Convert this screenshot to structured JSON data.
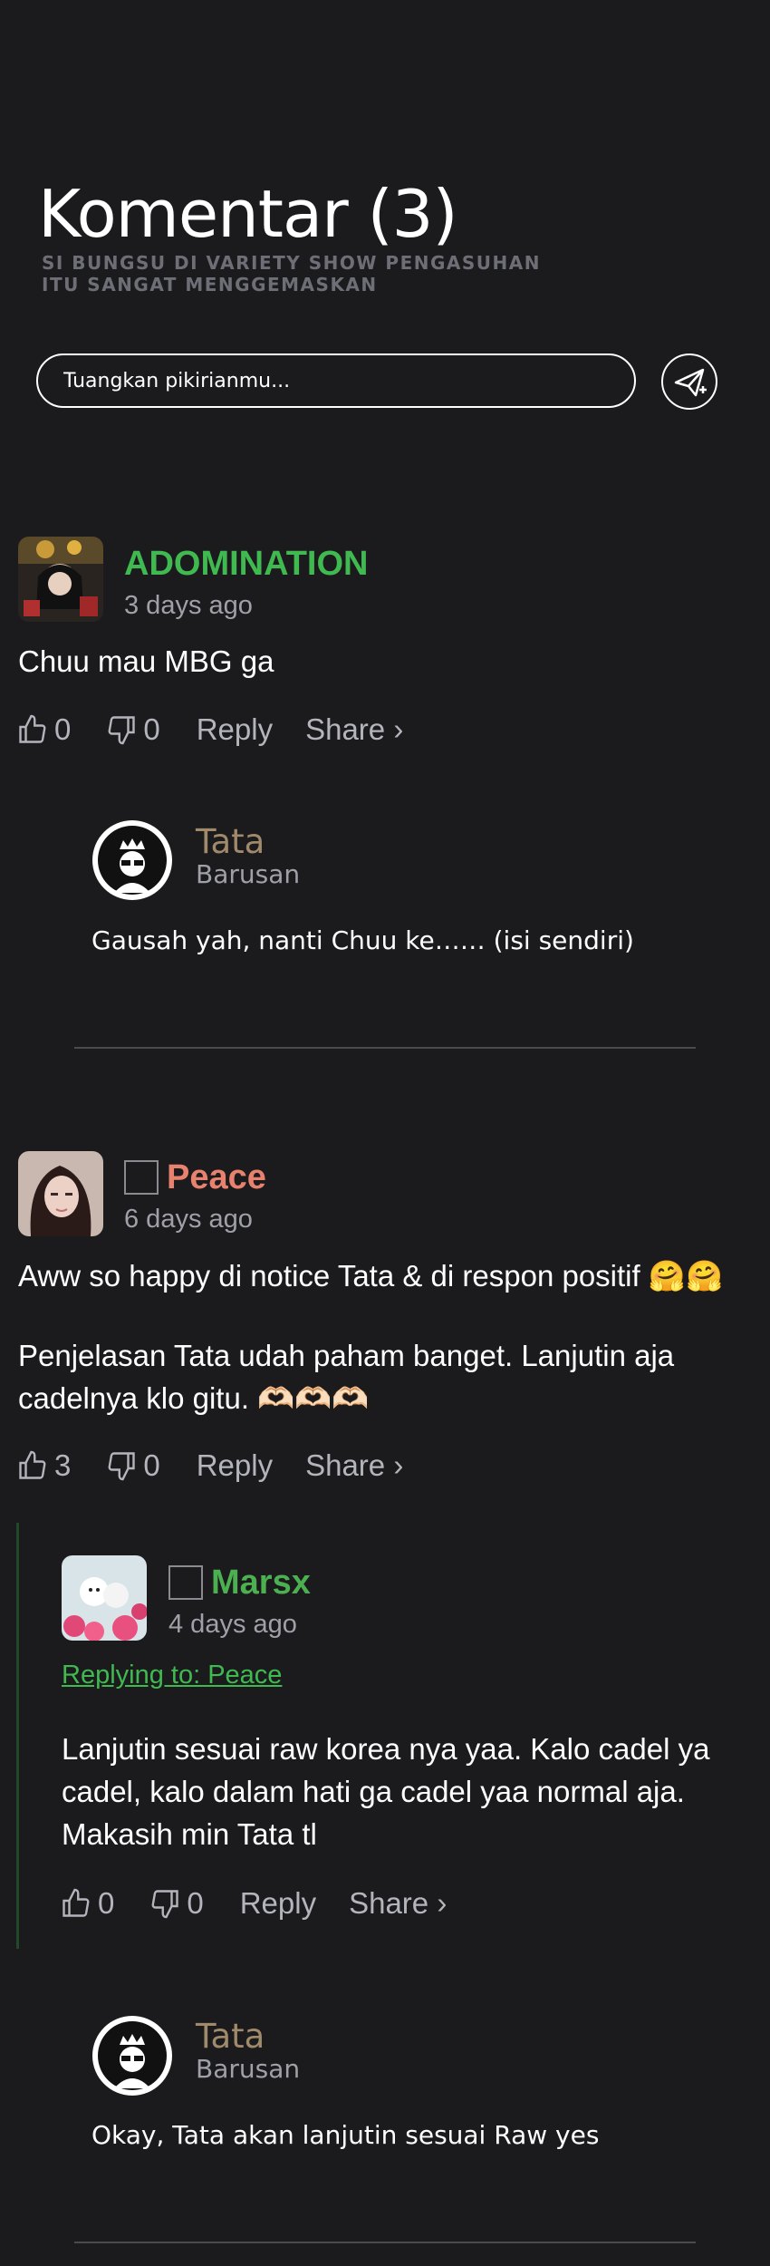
{
  "header": {
    "title": "Komentar (3)",
    "subtitle": "SI BUNGSU DI VARIETY SHOW PENGASUHAN ITU SANGAT MENGGEMASKAN",
    "input_placeholder": "Tuangkan pikirianmu...",
    "send_icon": "send-icon"
  },
  "comments": [
    {
      "username": "ADOMINATION",
      "username_color": "#3fb950",
      "time": "3 days ago",
      "text": "Chuu mau MBG ga",
      "likes": "0",
      "dislikes": "0",
      "reply_label": "Reply",
      "share_label": "Share ›",
      "admin_reply": {
        "name": "Tata",
        "time": "Barusan",
        "text": "Gausah yah, nanti Chuu ke…… (isi sendiri)"
      }
    },
    {
      "username": "Peace",
      "username_color": "#e8826e",
      "time": "6 days ago",
      "text_line1": "Aww so happy di notice Tata & di respon positif 🤗🤗",
      "text_line2": "Penjelasan Tata udah paham banget. Lanjutin aja",
      "text_line3": "cadelnya klo gitu. 🫶🏻🫶🏻🫶🏻",
      "likes": "3",
      "dislikes": "0",
      "reply_label": "Reply",
      "share_label": "Share ›",
      "reply": {
        "username": "Marsx",
        "username_color": "#4caf50",
        "time": "4 days ago",
        "replying_to": "Replying to: Peace",
        "text_line1": "Lanjutin sesuai raw korea nya yaa. Kalo cadel ya",
        "text_line2": "cadel, kalo dalam hati ga cadel yaa normal aja.",
        "text_line3": "Makasih min Tata tl",
        "likes": "0",
        "dislikes": "0",
        "reply_label": "Reply",
        "share_label": "Share ›"
      },
      "admin_reply": {
        "name": "Tata",
        "time": "Barusan",
        "text": "Okay, Tata akan lanjutin sesuai Raw yes"
      }
    }
  ]
}
